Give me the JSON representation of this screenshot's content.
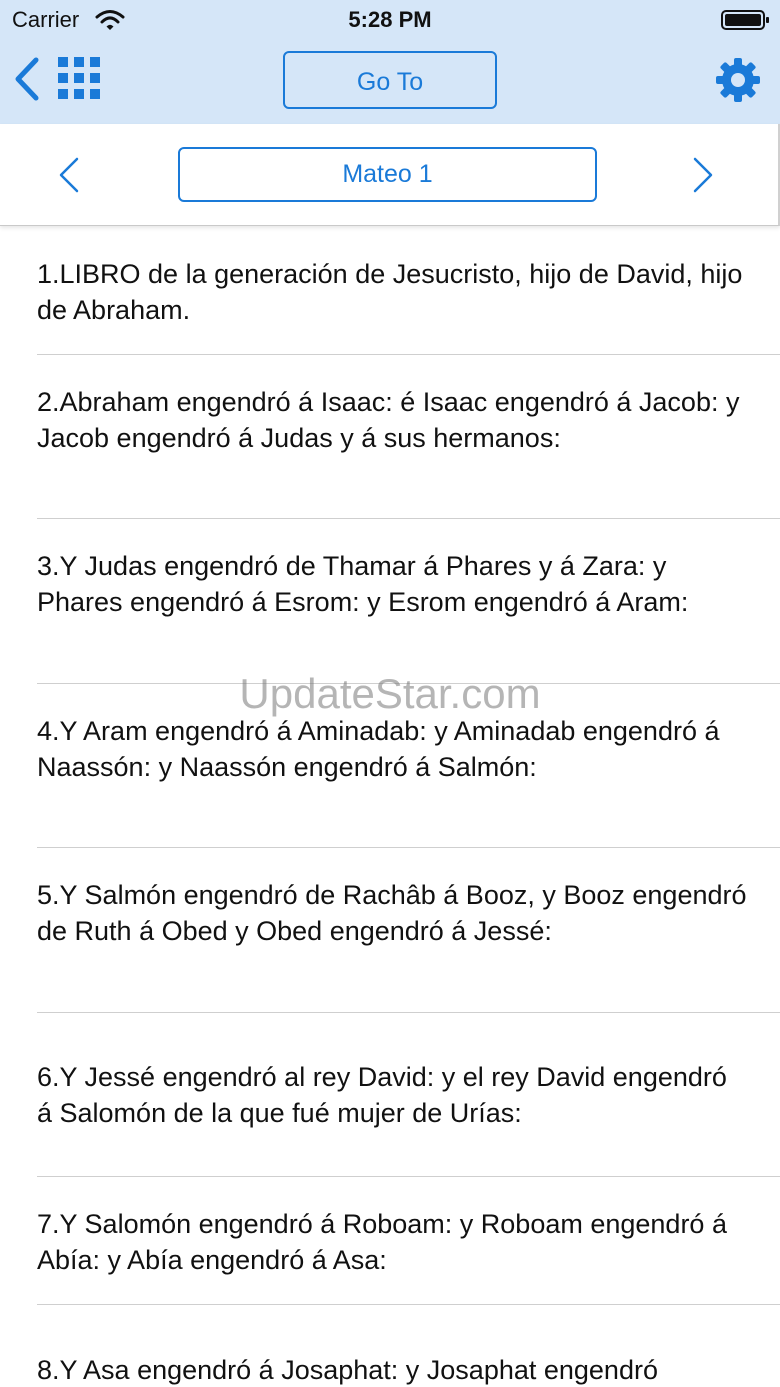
{
  "status_bar": {
    "carrier": "Carrier",
    "time": "5:28 PM"
  },
  "toolbar": {
    "back_icon": "chevron-left-icon",
    "grid_icon": "grid-icon",
    "goto_label": "Go To",
    "settings_icon": "gear-icon",
    "accent_color": "#1a7ad8",
    "bar_color": "#d5e6f8"
  },
  "chapter_nav": {
    "prev_icon": "chevron-left-icon",
    "next_icon": "chevron-right-icon",
    "current": "Mateo 1"
  },
  "verses": [
    "1.LIBRO de la generación de Jesucristo, hijo de David, hijo de Abraham.",
    "2.Abraham engendró á Isaac: é Isaac engendró á Jacob: y Jacob engendró á Judas y á sus hermanos:",
    "3.Y Judas engendró de Thamar á Phares y á Zara: y Phares engendró á Esrom: y Esrom engendró á Aram:",
    "4.Y Aram engendró á Aminadab: y Aminadab engendró á Naassón: y Naassón engendró á Salmón:",
    "5.Y Salmón engendró de Rachâb á Booz, y Booz engendró de Ruth á Obed y Obed engendró á Jessé:",
    "6.Y Jessé engendró al rey David: y el rey David engendró á Salomón de la que fué mujer de Urías:",
    "7.Y Salomón engendró á Roboam: y Roboam engendró á Abía: y Abía engendró á Asa:",
    "8.Y Asa engendró á Josaphat: y Josaphat engendró"
  ],
  "watermark": "UpdateStar.com"
}
